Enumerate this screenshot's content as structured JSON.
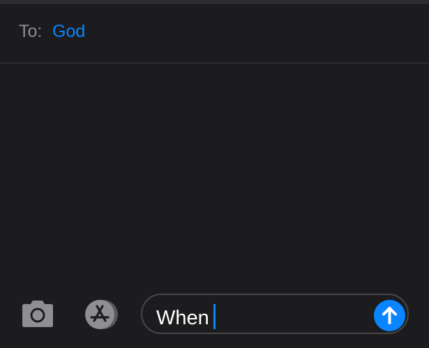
{
  "header": {
    "to_label": "To:",
    "recipient": "God"
  },
  "composer": {
    "text": "When",
    "camera_icon": "camera-icon",
    "apps_icon": "app-store-icon",
    "send_icon": "arrow-up-icon"
  },
  "colors": {
    "background": "#1c1c1e",
    "accent": "#0a84ff",
    "label_gray": "#8e8e93"
  }
}
